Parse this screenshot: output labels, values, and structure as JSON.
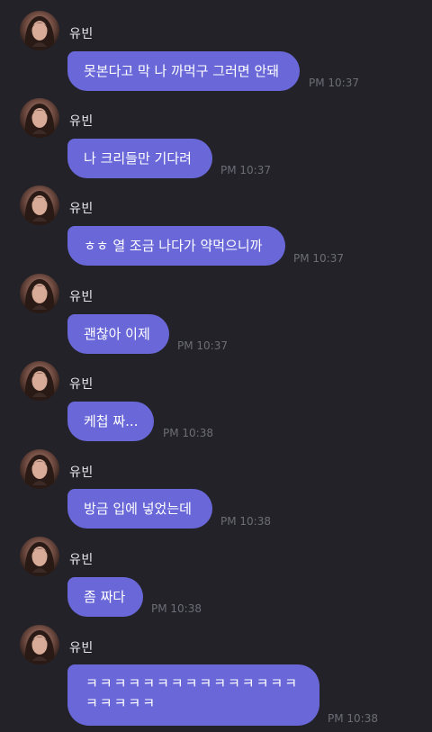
{
  "sender": {
    "name": "유빈"
  },
  "messages": [
    {
      "text": "못본다고 막 나 까먹구 그러면 안돼",
      "time": "PM 10:37"
    },
    {
      "text": "나 크리들만 기다려",
      "time": "PM 10:37"
    },
    {
      "text": "ㅎㅎ 열 조금 나다가 약먹으니까",
      "time": "PM 10:37"
    },
    {
      "text": "괜찮아 이제",
      "time": "PM 10:37"
    },
    {
      "text": "케첩 짜...",
      "time": "PM 10:38"
    },
    {
      "text": "방금 입에 넣었는데",
      "time": "PM 10:38"
    },
    {
      "text": "좀 짜다",
      "time": "PM 10:38"
    },
    {
      "text": "ㅋㅋㅋㅋㅋㅋㅋㅋㅋㅋㅋㅋㅋㅋㅋㅋㅋㅋㅋㅋ",
      "time": "PM 10:38"
    }
  ],
  "colors": {
    "background": "#222228",
    "bubble": "#6a68d8",
    "bubble_text": "#ffffff",
    "name_text": "#e6e6ea",
    "time_text": "#6d6d76"
  },
  "icons": {
    "avatar": "profile-photo"
  }
}
